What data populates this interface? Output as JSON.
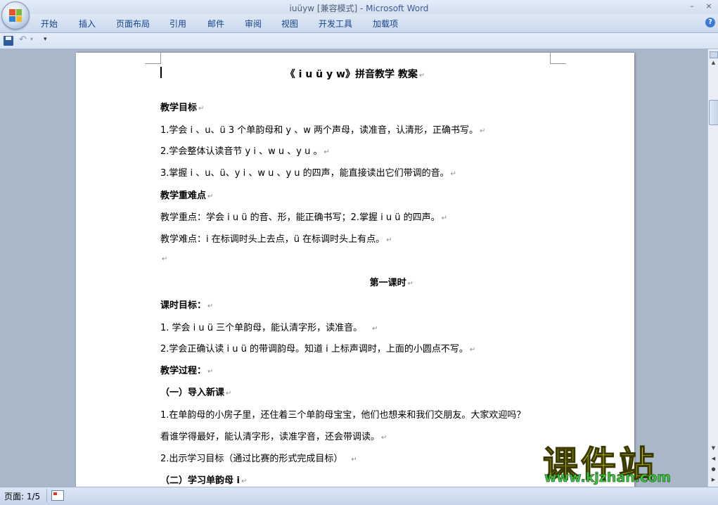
{
  "window": {
    "doc_name": "iuüyw [兼容模式]",
    "separator": " - ",
    "app_name": "Microsoft Word",
    "minimize": "–",
    "close": "×"
  },
  "ribbon": {
    "tabs": [
      "开始",
      "插入",
      "页面布局",
      "引用",
      "邮件",
      "审阅",
      "视图",
      "开发工具",
      "加载项"
    ],
    "help": "?"
  },
  "qat": {
    "undo": "↶",
    "undo_dropdown": "▾",
    "customize": "▾"
  },
  "document": {
    "title": "《 i u ü y w》拼音教学 教案",
    "lines": [
      {
        "text": "教学目标",
        "bold": true
      },
      {
        "text": "1.学会 i 、u、ü 3 个单韵母和 y 、w 两个声母，读准音，认清形，正确书写。",
        "bold": false
      },
      {
        "text": "2.学会整体认读音节 y i 、w u 、y u 。",
        "bold": false
      },
      {
        "text": "3.掌握 i 、u、ü、y i 、w u 、y u 的四声，能直接读出它们带调的音。",
        "bold": false
      },
      {
        "text": "教学重难点",
        "bold": true
      },
      {
        "text": "教学重点：学会 i u ü 的音、形，能正确书写；2.掌握 i u ü 的四声。",
        "bold": false
      },
      {
        "text": "教学难点：i 在标调时头上去点，ü 在标调时头上有点。",
        "bold": false
      },
      {
        "text": "",
        "bold": false
      },
      {
        "text": "第一课时",
        "bold": true,
        "center": true
      },
      {
        "text": "课时目标：",
        "bold": true
      },
      {
        "text": "1. 学会 i u ü 三个单韵母，能认清字形，读准音。",
        "bold": false
      },
      {
        "text": "2.学会正确认读 i u ü 的带调韵母。知道 i 上标声调时，上面的小圆点不写。",
        "bold": false
      },
      {
        "text": "教学过程：",
        "bold": true
      },
      {
        "text": "（一）导入新课",
        "bold": true
      },
      {
        "text": " 1.在单韵母的小房子里，还住着三个单韵母宝宝，他们也想来和我们交朋友。大家欢迎吗？",
        "bold": false
      },
      {
        "text": "看谁学得最好，能认清字形，读准字音，还会带调读。",
        "bold": false
      },
      {
        "text": " 2.出示学习目标（通过比赛的形式完成目标）",
        "bold": false
      },
      {
        "text": "（二）学习单韵母 i",
        "bold": true
      }
    ],
    "paragraph_mark": "↵"
  },
  "scrollbar": {
    "up": "▲",
    "down": "▼",
    "prev_page": "◀",
    "select_browse": "●",
    "next_page": "▶"
  },
  "status": {
    "pages": "页面: 1/5"
  },
  "watermark": {
    "cn": "课件站",
    "url": "www.kjzhan.com"
  }
}
